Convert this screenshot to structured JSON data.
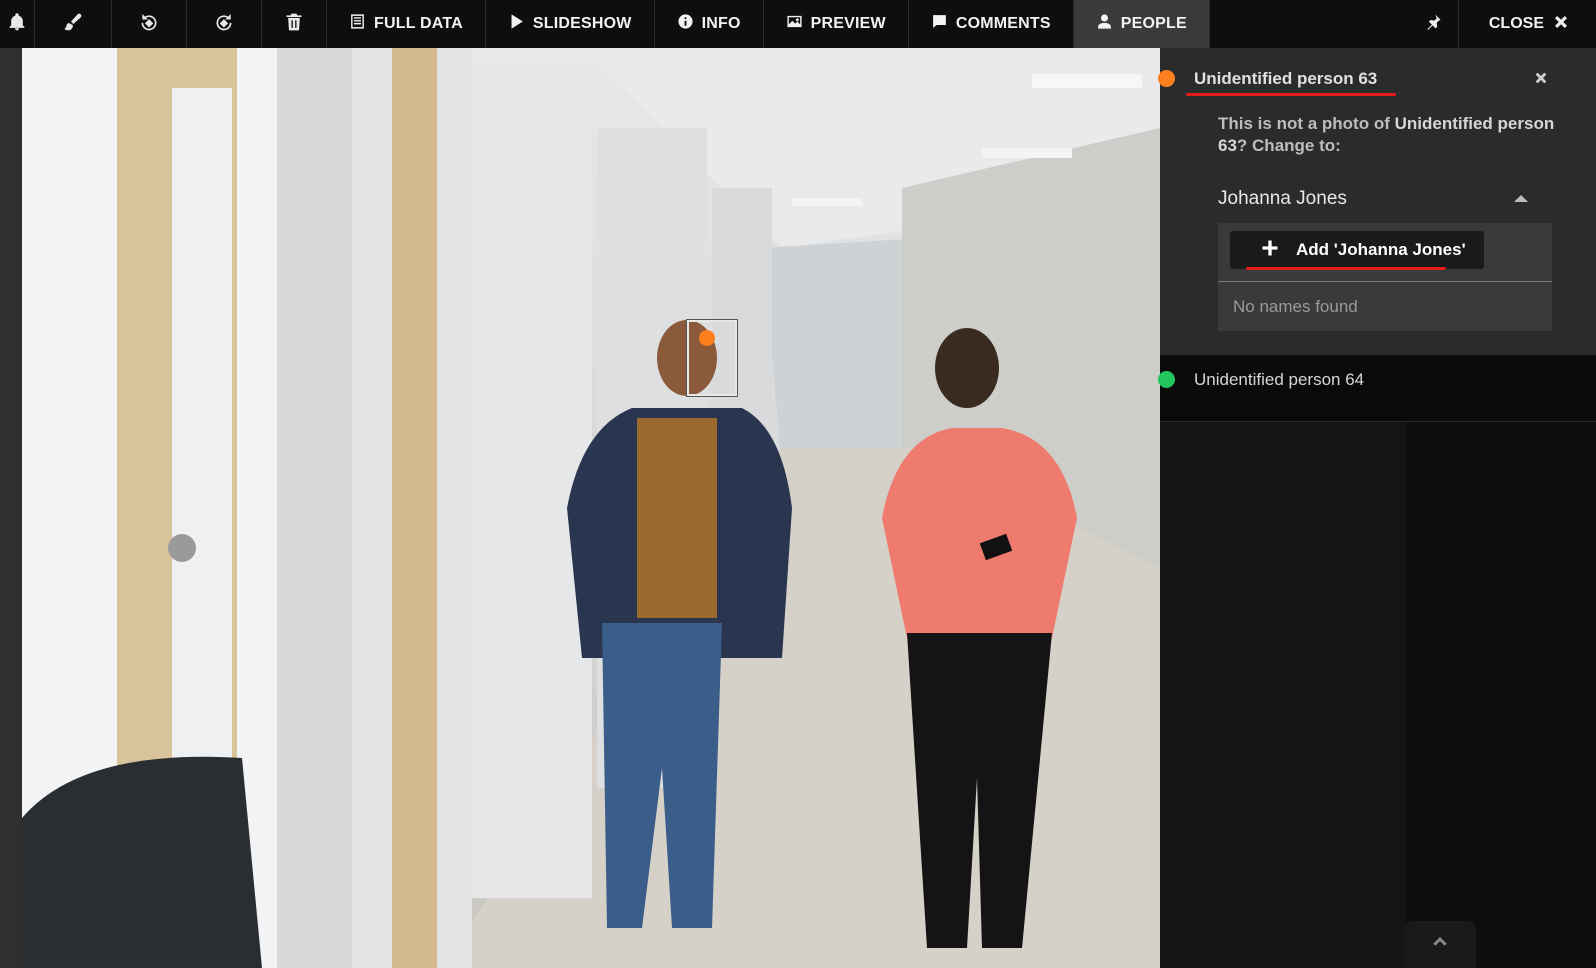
{
  "toolbar": {
    "icons": [
      "bell-icon",
      "paintbrush-icon",
      "rotate-left-icon",
      "rotate-right-icon",
      "trash-icon"
    ],
    "full_data_label": "FULL DATA",
    "slideshow_label": "SLIDESHOW",
    "info_label": "INFO",
    "preview_label": "PREVIEW",
    "comments_label": "COMMENTS",
    "people_label": "PEOPLE",
    "close_label": "CLOSE"
  },
  "people_panel": {
    "active_person": {
      "name": "Unidentified person 63",
      "status_color": "#ff7f1f"
    },
    "change_message": {
      "prefix": "This is not a photo of ",
      "name": "Unidentified person 63",
      "suffix": "? Change to:"
    },
    "name_select": {
      "value": "Johanna Jones"
    },
    "dropdown": {
      "add_label": "Add 'Johanna Jones'",
      "empty_text": "No names found"
    },
    "other_person": {
      "name": "Unidentified person 64",
      "status_color": "#22c55e"
    }
  },
  "colors": {
    "accent_underline": "#e31b1b",
    "active_tab_bg": "#3a3a3a"
  }
}
